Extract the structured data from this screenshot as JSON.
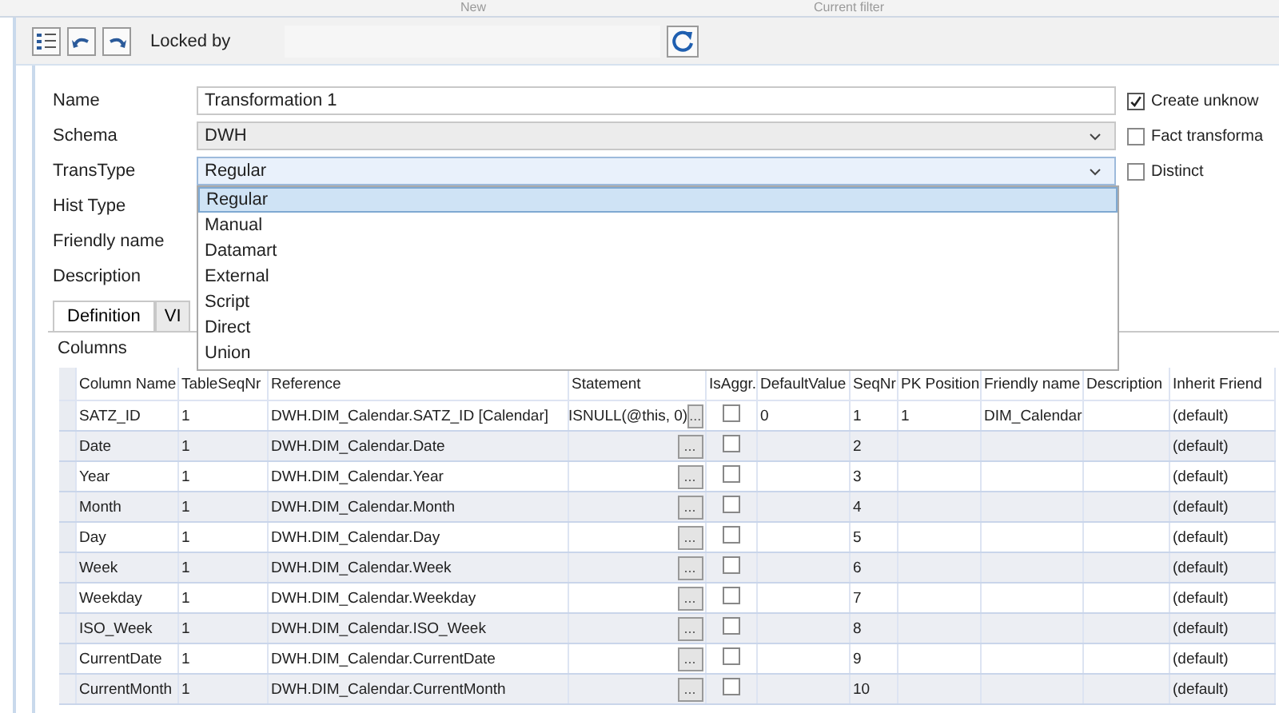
{
  "top_strip": {
    "headers": [
      "New",
      "Current filter"
    ]
  },
  "toolbar": {
    "locked_by_label": "Locked by"
  },
  "form": {
    "fields": [
      {
        "label": "Name",
        "kind": "text",
        "value": "Transformation 1"
      },
      {
        "label": "Schema",
        "kind": "combo",
        "value": "DWH"
      },
      {
        "label": "TransType",
        "kind": "combo",
        "value": "Regular",
        "expanded": true
      },
      {
        "label": "Hist Type",
        "kind": "text"
      },
      {
        "label": "Friendly name",
        "kind": "text"
      },
      {
        "label": "Description",
        "kind": "text"
      }
    ],
    "options": [
      {
        "label": "Create unknow",
        "checked": true
      },
      {
        "label": "Fact transforma",
        "checked": false
      },
      {
        "label": "Distinct",
        "checked": false
      }
    ]
  },
  "dropdown": {
    "items": [
      {
        "label": "Regular",
        "selected": true
      },
      {
        "label": "Manual",
        "selected": false
      },
      {
        "label": "Datamart",
        "selected": false
      },
      {
        "label": "External",
        "selected": false
      },
      {
        "label": "Script",
        "selected": false
      },
      {
        "label": "Direct",
        "selected": false
      },
      {
        "label": "Union",
        "selected": false
      }
    ]
  },
  "tabs": [
    {
      "label": "Definition",
      "selected": true
    },
    {
      "label": "VI",
      "selected": false
    }
  ],
  "columns_label": "Columns",
  "table": {
    "button_label": "...",
    "columns": [
      "Column Name",
      "TableSeqNr",
      "Reference",
      "Statement",
      "IsAggr.",
      "DefaultValue",
      "SeqNr",
      "PK Position",
      "Friendly name",
      "Description",
      "Inherit Friend"
    ],
    "rows": [
      {
        "cells": [
          "SATZ_ID",
          "1",
          "DWH.DIM_Calendar.SATZ_ID [Calendar]",
          "ISNULL(@this, 0)",
          "",
          "0",
          "1",
          "1",
          "DIM_Calendar",
          "",
          "(default)"
        ],
        "aggr": false
      },
      {
        "cells": [
          "Date",
          "1",
          "DWH.DIM_Calendar.Date",
          "",
          "",
          "",
          "2",
          "",
          "",
          "",
          "(default)"
        ],
        "aggr": false
      },
      {
        "cells": [
          "Year",
          "1",
          "DWH.DIM_Calendar.Year",
          "",
          "",
          "",
          "3",
          "",
          "",
          "",
          "(default)"
        ],
        "aggr": false
      },
      {
        "cells": [
          "Month",
          "1",
          "DWH.DIM_Calendar.Month",
          "",
          "",
          "",
          "4",
          "",
          "",
          "",
          "(default)"
        ],
        "aggr": false
      },
      {
        "cells": [
          "Day",
          "1",
          "DWH.DIM_Calendar.Day",
          "",
          "",
          "",
          "5",
          "",
          "",
          "",
          "(default)"
        ],
        "aggr": false
      },
      {
        "cells": [
          "Week",
          "1",
          "DWH.DIM_Calendar.Week",
          "",
          "",
          "",
          "6",
          "",
          "",
          "",
          "(default)"
        ],
        "aggr": false
      },
      {
        "cells": [
          "Weekday",
          "1",
          "DWH.DIM_Calendar.Weekday",
          "",
          "",
          "",
          "7",
          "",
          "",
          "",
          "(default)"
        ],
        "aggr": false
      },
      {
        "cells": [
          "ISO_Week",
          "1",
          "DWH.DIM_Calendar.ISO_Week",
          "",
          "",
          "",
          "8",
          "",
          "",
          "",
          "(default)"
        ],
        "aggr": false
      },
      {
        "cells": [
          "CurrentDate",
          "1",
          "DWH.DIM_Calendar.CurrentDate",
          "",
          "",
          "",
          "9",
          "",
          "",
          "",
          "(default)"
        ],
        "aggr": false
      },
      {
        "cells": [
          "CurrentMonth",
          "1",
          "DWH.DIM_Calendar.CurrentMonth",
          "",
          "",
          "",
          "10",
          "",
          "",
          "",
          "(default)"
        ],
        "aggr": false
      }
    ]
  }
}
